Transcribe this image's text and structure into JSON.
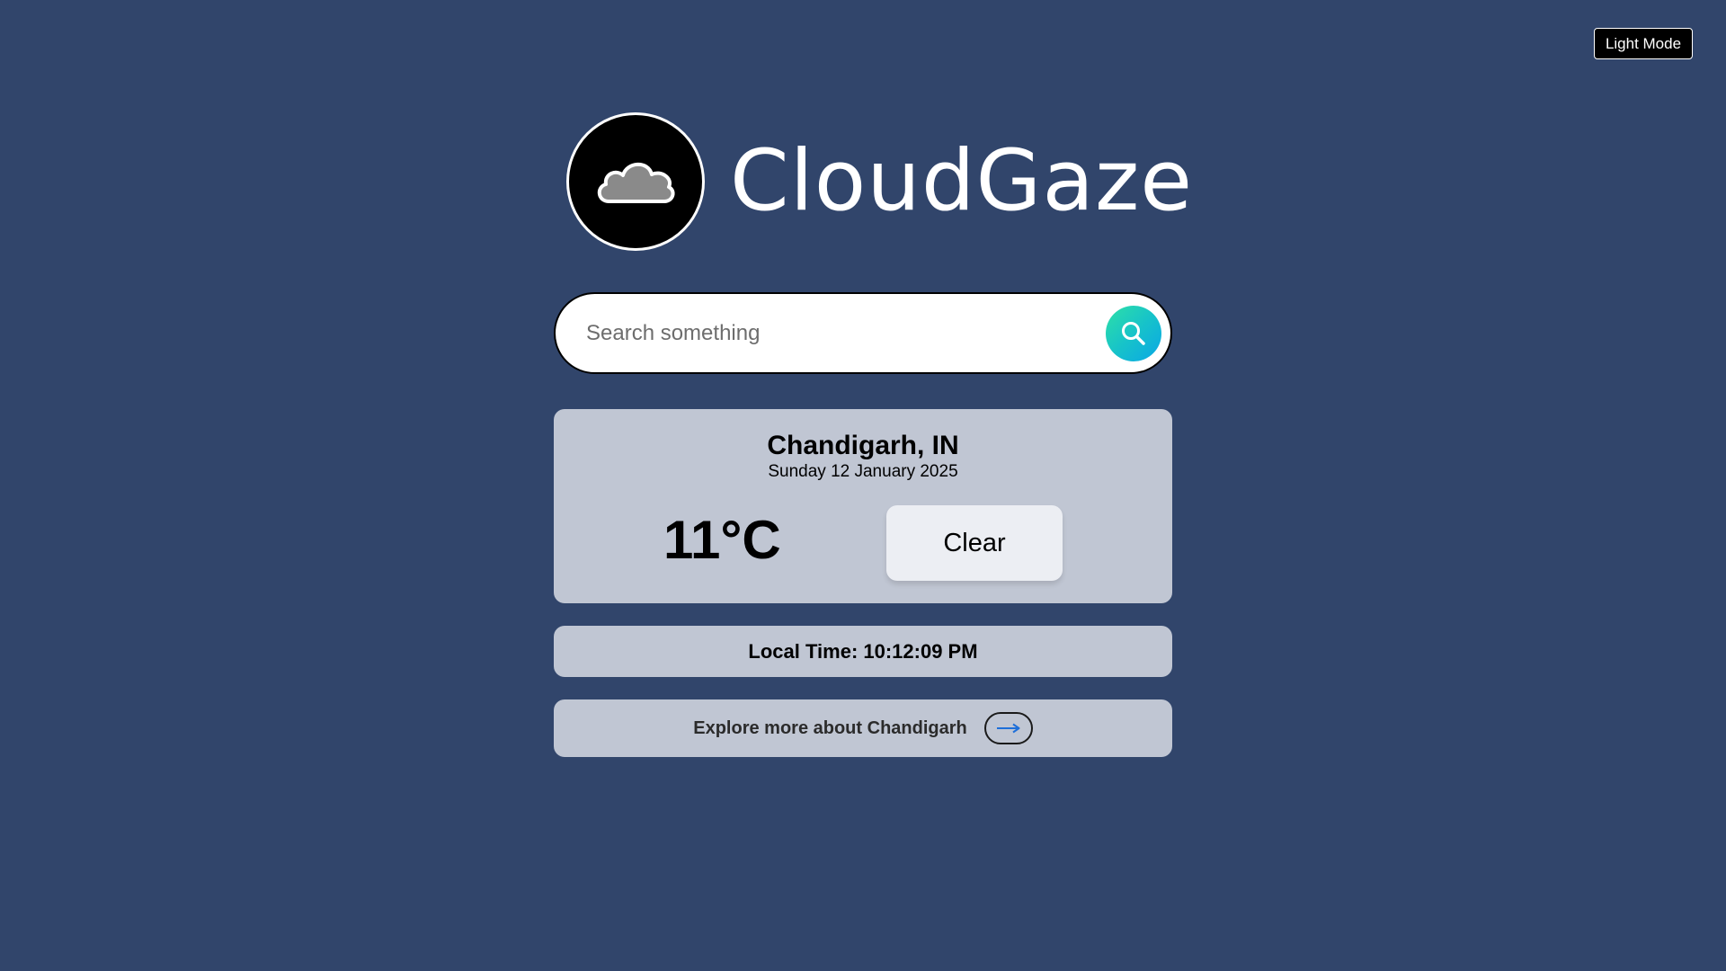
{
  "theme_toggle": {
    "label": "Light Mode"
  },
  "app": {
    "title": "CloudGaze",
    "logo_icon": "cloud-icon"
  },
  "search": {
    "placeholder": "Search something",
    "value": "",
    "icon": "search-icon"
  },
  "weather": {
    "location": "Chandigarh, IN",
    "date": "Sunday 12 January 2025",
    "temperature": "11°C",
    "condition": "Clear"
  },
  "local_time": {
    "text": "Local Time: 10:12:09 PM"
  },
  "explore": {
    "label": "Explore more about Chandigarh",
    "icon": "arrow-right-icon"
  },
  "colors": {
    "background": "#31456b",
    "card": "#c0c6d3",
    "condition_chip": "#eceef3",
    "search_button_gradient_start": "#2ee0a6",
    "search_button_gradient_end": "#0aa7e6",
    "arrow": "#1e6fd9"
  }
}
